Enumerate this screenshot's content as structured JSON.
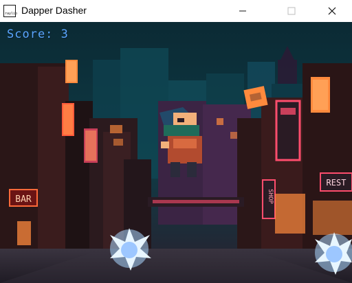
{
  "window": {
    "title": "Dapper Dasher",
    "icon_label": "raylib",
    "buttons": [
      "minimize-icon",
      "maximize-icon",
      "close-icon"
    ]
  },
  "hud": {
    "score_text": "Score: 3"
  },
  "scene": {
    "signs": {
      "bar": "BAR",
      "shop": "SHOP",
      "rest": "REST"
    }
  },
  "colors": {
    "sky_top": "#0b2a34",
    "sky_mid": "#0f3b46",
    "neon_pink": "#ff4d6d",
    "neon_orange": "#ff8a3d",
    "score_blue": "#5aa7ff"
  }
}
